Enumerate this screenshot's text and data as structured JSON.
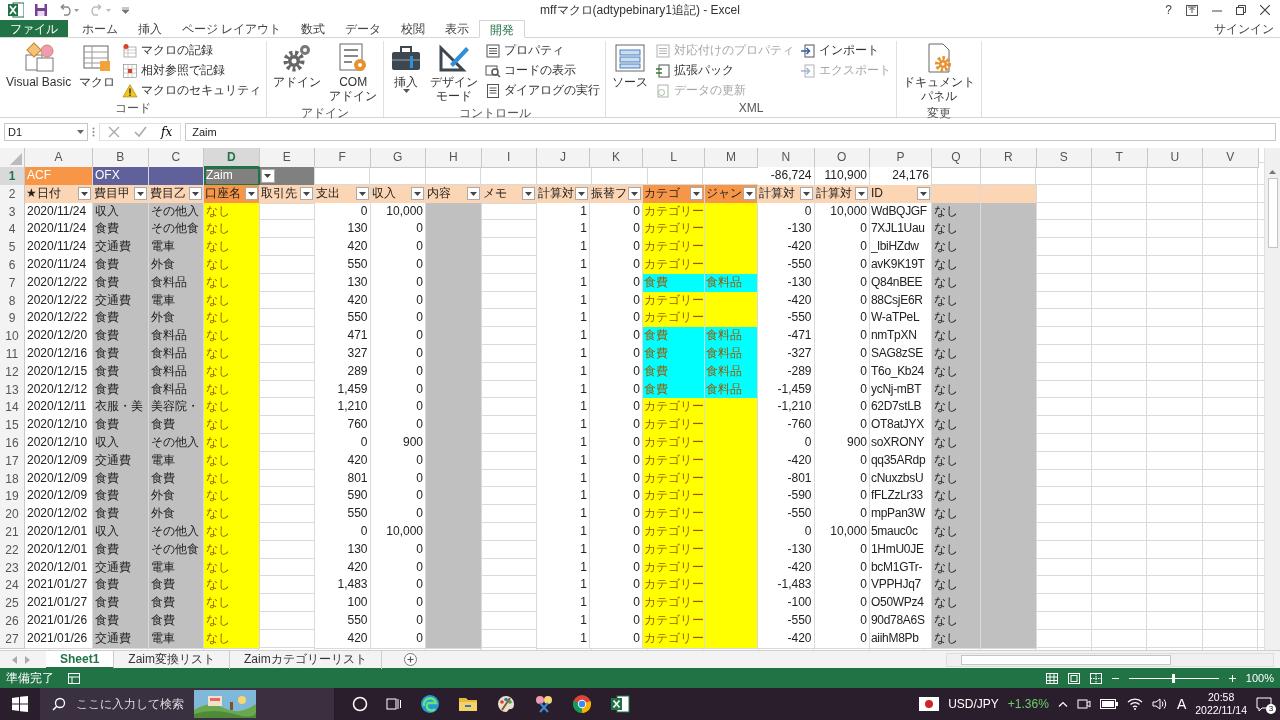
{
  "window": {
    "title": "mffマクロ(adtypebinary1追記) - Excel",
    "help": "?",
    "account": "サインイン"
  },
  "ribbon_tabs": [
    {
      "label": "ファイル",
      "kind": "file",
      "selected": false
    },
    {
      "label": "ホーム",
      "kind": "tab",
      "selected": false
    },
    {
      "label": "挿入",
      "kind": "tab",
      "selected": false
    },
    {
      "label": "ページ レイアウト",
      "kind": "tab",
      "selected": false
    },
    {
      "label": "数式",
      "kind": "tab",
      "selected": false
    },
    {
      "label": "データ",
      "kind": "tab",
      "selected": false
    },
    {
      "label": "校閲",
      "kind": "tab",
      "selected": false
    },
    {
      "label": "表示",
      "kind": "tab",
      "selected": false
    },
    {
      "label": "開発",
      "kind": "tab",
      "selected": true
    }
  ],
  "ribbon_groups": [
    {
      "name": "コード",
      "items": [
        {
          "kind": "large",
          "lines": [
            "Visual Basic"
          ],
          "disabled": false
        },
        {
          "kind": "large",
          "lines": [
            "マクロ"
          ],
          "disabled": false
        },
        {
          "kind": "small",
          "label": "マクロの記録",
          "disabled": false
        },
        {
          "kind": "small",
          "label": "相対参照で記録",
          "disabled": false
        },
        {
          "kind": "small",
          "label": "マクロのセキュリティ",
          "disabled": false
        }
      ]
    },
    {
      "name": "アドイン",
      "items": [
        {
          "kind": "large",
          "lines": [
            "アドイン"
          ],
          "disabled": false
        },
        {
          "kind": "large",
          "lines": [
            "COM",
            "アドイン"
          ],
          "disabled": false
        }
      ]
    },
    {
      "name": "コントロール",
      "items": [
        {
          "kind": "large",
          "lines": [
            "挿入"
          ],
          "disabled": false,
          "dropdown": true
        },
        {
          "kind": "large",
          "lines": [
            "デザイン",
            "モード"
          ],
          "disabled": false
        },
        {
          "kind": "small",
          "label": "プロパティ",
          "disabled": false
        },
        {
          "kind": "small",
          "label": "コードの表示",
          "disabled": false
        },
        {
          "kind": "small",
          "label": "ダイアログの実行",
          "disabled": false
        }
      ]
    },
    {
      "name": "XML",
      "items": [
        {
          "kind": "large",
          "lines": [
            "ソース"
          ],
          "disabled": false
        },
        {
          "kind": "small",
          "label": "対応付けのプロパティ",
          "disabled": true
        },
        {
          "kind": "small",
          "label": "拡張パック",
          "disabled": false
        },
        {
          "kind": "small",
          "label": "データの更新",
          "disabled": true
        },
        {
          "kind": "small",
          "label": "インポート",
          "disabled": false
        },
        {
          "kind": "small",
          "label": "エクスポート",
          "disabled": true
        }
      ]
    },
    {
      "name": "変更",
      "items": [
        {
          "kind": "large",
          "lines": [
            "ドキュメント",
            "パネル"
          ],
          "disabled": false
        }
      ]
    }
  ],
  "formula_bar": {
    "name_box": "D1",
    "fx": "fx",
    "formula": "Zaim"
  },
  "sheet": {
    "columns": [
      {
        "letter": "A",
        "selected": false,
        "kind": "text",
        "header": {
          "text": "★日付",
          "color": "#fcd5b4"
        },
        "filter": true
      },
      {
        "letter": "B",
        "selected": false,
        "kind": "text",
        "header": {
          "text": "費目甲",
          "color": "#fcd5b4"
        },
        "filter": true,
        "color": "#c0c0c0"
      },
      {
        "letter": "C",
        "selected": false,
        "kind": "text",
        "header": {
          "text": "費目乙",
          "color": "#fcd5b4"
        },
        "filter": true,
        "color": "#c0c0c0"
      },
      {
        "letter": "D",
        "selected": true,
        "kind": "account",
        "header": {
          "text": "口座名",
          "color": "#f79646"
        },
        "filter": true,
        "color": "#ffff00"
      },
      {
        "letter": "E",
        "selected": false,
        "kind": "text",
        "header": {
          "text": "取引先",
          "color": "#fcd5b4"
        },
        "filter": true
      },
      {
        "letter": "F",
        "selected": false,
        "kind": "number",
        "header": {
          "text": "支出",
          "color": "#fcd5b4"
        },
        "filter": true
      },
      {
        "letter": "G",
        "selected": false,
        "kind": "number",
        "header": {
          "text": "収入",
          "color": "#fcd5b4"
        },
        "filter": true
      },
      {
        "letter": "H",
        "selected": false,
        "kind": "text",
        "header": {
          "text": "内容",
          "color": "#fcd5b4"
        },
        "filter": true,
        "color": "#c0c0c0"
      },
      {
        "letter": "I",
        "selected": false,
        "kind": "text",
        "header": {
          "text": "メモ",
          "color": "#fcd5b4"
        },
        "filter": true
      },
      {
        "letter": "J",
        "selected": false,
        "kind": "number",
        "header": {
          "text": "計算対",
          "color": "#fcd5b4"
        },
        "filter": true
      },
      {
        "letter": "K",
        "selected": false,
        "kind": "number",
        "header": {
          "text": "振替フ",
          "color": "#fcd5b4"
        },
        "filter": true
      },
      {
        "letter": "L",
        "selected": false,
        "kind": "category",
        "header": {
          "text": "カテゴ",
          "color": "#f79646"
        },
        "filter": true
      },
      {
        "letter": "M",
        "selected": false,
        "kind": "category",
        "header": {
          "text": "ジャン",
          "color": "#f79646"
        },
        "filter": true
      },
      {
        "letter": "N",
        "selected": false,
        "kind": "number",
        "header": {
          "text": "計算対",
          "color": "#fcd5b4"
        },
        "filter": true
      },
      {
        "letter": "O",
        "selected": false,
        "kind": "number",
        "header": {
          "text": "計算対",
          "color": "#fcd5b4"
        },
        "filter": true
      },
      {
        "letter": "P",
        "selected": false,
        "kind": "id",
        "header": {
          "text": "ID",
          "color": "#fcd5b4"
        },
        "filter": true
      },
      {
        "letter": "Q",
        "selected": false,
        "kind": "text",
        "header": {
          "color": "#fcd5b4"
        },
        "filter": false,
        "color": "#c0c0c0"
      },
      {
        "letter": "R",
        "selected": false,
        "kind": "text",
        "header": {
          "color": "#fcd5b4"
        },
        "filter": false,
        "color": "#c0c0c0"
      },
      {
        "letter": "S",
        "selected": false,
        "kind": "text"
      },
      {
        "letter": "T",
        "selected": false,
        "kind": "text"
      },
      {
        "letter": "U",
        "selected": false,
        "kind": "text"
      },
      {
        "letter": "V",
        "selected": false,
        "kind": "text"
      }
    ],
    "row1": {
      "number": "1",
      "selected": true,
      "cells": {
        "A": {
          "text": "ACF",
          "color": "#f79646",
          "selected": false
        },
        "B": {
          "text": "OFX",
          "color": "#60609a",
          "selected": false
        },
        "C": {
          "color": "#60609a",
          "selected": false
        },
        "D": {
          "text": "Zaim",
          "color": "#808080",
          "dropdown": true,
          "selected": true
        },
        "E": {
          "color": "#808080",
          "selected": false
        },
        "N": {
          "text": "-86,724",
          "selected": false
        },
        "O": {
          "text": "110,900",
          "selected": false
        },
        "P": {
          "text": "24,176",
          "selected": false
        }
      }
    },
    "row2": {
      "number": "2",
      "selected": false
    },
    "rows": [
      {
        "number": "3",
        "selected": false,
        "color": "#ffff00",
        "A": "2020/11/24",
        "B": "収入",
        "C": "その他入",
        "D": "なし",
        "F": "0",
        "G": "10,000",
        "J": "1",
        "K": "0",
        "L": "カテゴリー",
        "N": "0",
        "O": "10,000",
        "P": "WdBQJGF",
        "Q": "なし"
      },
      {
        "number": "4",
        "selected": false,
        "color": "#ffff00",
        "A": "2020/11/24",
        "B": "食費",
        "C": "その他食",
        "D": "なし",
        "F": "130",
        "G": "0",
        "J": "1",
        "K": "0",
        "L": "カテゴリー",
        "N": "-130",
        "O": "0",
        "P": "7XJL1Uau",
        "Q": "なし"
      },
      {
        "number": "5",
        "selected": false,
        "color": "#ffff00",
        "A": "2020/11/24",
        "B": "交通費",
        "C": "電車",
        "D": "なし",
        "F": "420",
        "G": "0",
        "J": "1",
        "K": "0",
        "L": "カテゴリー",
        "N": "-420",
        "O": "0",
        "P": "_lbiHZdw",
        "Q": "なし"
      },
      {
        "number": "6",
        "selected": false,
        "color": "#ffff00",
        "A": "2020/11/24",
        "B": "食費",
        "C": "外食",
        "D": "なし",
        "F": "550",
        "G": "0",
        "J": "1",
        "K": "0",
        "L": "カテゴリー",
        "N": "-550",
        "O": "0",
        "P": "avK9K19T",
        "Q": "なし"
      },
      {
        "number": "7",
        "selected": false,
        "color": "#00ffff",
        "A": "2020/12/22",
        "B": "食費",
        "C": "食料品",
        "D": "なし",
        "F": "130",
        "G": "0",
        "J": "1",
        "K": "0",
        "L": "食費",
        "M": "食料品",
        "N": "-130",
        "O": "0",
        "P": "Q84nBEE",
        "Q": "なし"
      },
      {
        "number": "8",
        "selected": false,
        "color": "#ffff00",
        "A": "2020/12/22",
        "B": "交通費",
        "C": "電車",
        "D": "なし",
        "F": "420",
        "G": "0",
        "J": "1",
        "K": "0",
        "L": "カテゴリー",
        "N": "-420",
        "O": "0",
        "P": "88CsjE6R",
        "Q": "なし"
      },
      {
        "number": "9",
        "selected": false,
        "color": "#ffff00",
        "A": "2020/12/22",
        "B": "食費",
        "C": "外食",
        "D": "なし",
        "F": "550",
        "G": "0",
        "J": "1",
        "K": "0",
        "L": "カテゴリー",
        "N": "-550",
        "O": "0",
        "P": "W-aTPeL",
        "Q": "なし"
      },
      {
        "number": "10",
        "selected": false,
        "color": "#00ffff",
        "A": "2020/12/20",
        "B": "食費",
        "C": "食料品",
        "D": "なし",
        "F": "471",
        "G": "0",
        "J": "1",
        "K": "0",
        "L": "食費",
        "M": "食料品",
        "N": "-471",
        "O": "0",
        "P": "nmTpXN",
        "Q": "なし"
      },
      {
        "number": "11",
        "selected": false,
        "color": "#00ffff",
        "A": "2020/12/16",
        "B": "食費",
        "C": "食料品",
        "D": "なし",
        "F": "327",
        "G": "0",
        "J": "1",
        "K": "0",
        "L": "食費",
        "M": "食料品",
        "N": "-327",
        "O": "0",
        "P": "SAG8zSE",
        "Q": "なし"
      },
      {
        "number": "12",
        "selected": false,
        "color": "#00ffff",
        "A": "2020/12/15",
        "B": "食費",
        "C": "食料品",
        "D": "なし",
        "F": "289",
        "G": "0",
        "J": "1",
        "K": "0",
        "L": "食費",
        "M": "食料品",
        "N": "-289",
        "O": "0",
        "P": "T6o_Kb24",
        "Q": "なし"
      },
      {
        "number": "13",
        "selected": false,
        "color": "#00ffff",
        "A": "2020/12/12",
        "B": "食費",
        "C": "食料品",
        "D": "なし",
        "F": "1,459",
        "G": "0",
        "J": "1",
        "K": "0",
        "L": "食費",
        "M": "食料品",
        "N": "-1,459",
        "O": "0",
        "P": "ycNj-mBT",
        "Q": "なし"
      },
      {
        "number": "14",
        "selected": false,
        "color": "#ffff00",
        "A": "2020/12/11",
        "B": "衣服・美",
        "C": "美容院・",
        "D": "なし",
        "F": "1,210",
        "G": "0",
        "J": "1",
        "K": "0",
        "L": "カテゴリー",
        "N": "-1,210",
        "O": "0",
        "P": "62D7stLB",
        "Q": "なし"
      },
      {
        "number": "15",
        "selected": false,
        "color": "#ffff00",
        "A": "2020/12/10",
        "B": "食費",
        "C": "食費",
        "D": "なし",
        "F": "760",
        "G": "0",
        "J": "1",
        "K": "0",
        "L": "カテゴリー",
        "N": "-760",
        "O": "0",
        "P": "OT8atJYX",
        "Q": "なし"
      },
      {
        "number": "16",
        "selected": false,
        "color": "#ffff00",
        "A": "2020/12/10",
        "B": "収入",
        "C": "その他入",
        "D": "なし",
        "F": "0",
        "G": "900",
        "J": "1",
        "K": "0",
        "L": "カテゴリー",
        "N": "0",
        "O": "900",
        "P": "soXRONY",
        "Q": "なし"
      },
      {
        "number": "17",
        "selected": false,
        "color": "#ffff00",
        "A": "2020/12/09",
        "B": "交通費",
        "C": "電車",
        "D": "なし",
        "F": "420",
        "G": "0",
        "J": "1",
        "K": "0",
        "L": "カテゴリー",
        "N": "-420",
        "O": "0",
        "P": "qq35ARdp",
        "Q": "なし"
      },
      {
        "number": "18",
        "selected": false,
        "color": "#ffff00",
        "A": "2020/12/09",
        "B": "食費",
        "C": "食費",
        "D": "なし",
        "F": "801",
        "G": "0",
        "J": "1",
        "K": "0",
        "L": "カテゴリー",
        "N": "-801",
        "O": "0",
        "P": "cNuxzbsU",
        "Q": "なし"
      },
      {
        "number": "19",
        "selected": false,
        "color": "#ffff00",
        "A": "2020/12/09",
        "B": "食費",
        "C": "外食",
        "D": "なし",
        "F": "590",
        "G": "0",
        "J": "1",
        "K": "0",
        "L": "カテゴリー",
        "N": "-590",
        "O": "0",
        "P": "fFLZzLr33",
        "Q": "なし"
      },
      {
        "number": "20",
        "selected": false,
        "color": "#ffff00",
        "A": "2020/12/02",
        "B": "食費",
        "C": "外食",
        "D": "なし",
        "F": "550",
        "G": "0",
        "J": "1",
        "K": "0",
        "L": "カテゴリー",
        "N": "-550",
        "O": "0",
        "P": "mpPan3W",
        "Q": "なし"
      },
      {
        "number": "21",
        "selected": false,
        "color": "#ffff00",
        "A": "2020/12/01",
        "B": "収入",
        "C": "その他入",
        "D": "なし",
        "F": "0",
        "G": "10,000",
        "J": "1",
        "K": "0",
        "L": "カテゴリー",
        "N": "0",
        "O": "10,000",
        "P": "5mauc0c",
        "Q": "なし"
      },
      {
        "number": "22",
        "selected": false,
        "color": "#ffff00",
        "A": "2020/12/01",
        "B": "食費",
        "C": "その他食",
        "D": "なし",
        "F": "130",
        "G": "0",
        "J": "1",
        "K": "0",
        "L": "カテゴリー",
        "N": "-130",
        "O": "0",
        "P": "1HmU0JE",
        "Q": "なし"
      },
      {
        "number": "23",
        "selected": false,
        "color": "#ffff00",
        "A": "2020/12/01",
        "B": "交通費",
        "C": "電車",
        "D": "なし",
        "F": "420",
        "G": "0",
        "J": "1",
        "K": "0",
        "L": "カテゴリー",
        "N": "-420",
        "O": "0",
        "P": "bcM1GTr-",
        "Q": "なし"
      },
      {
        "number": "24",
        "selected": false,
        "color": "#ffff00",
        "A": "2021/01/27",
        "B": "食費",
        "C": "食費",
        "D": "なし",
        "F": "1,483",
        "G": "0",
        "J": "1",
        "K": "0",
        "L": "カテゴリー",
        "N": "-1,483",
        "O": "0",
        "P": "VPPHJq7",
        "Q": "なし"
      },
      {
        "number": "25",
        "selected": false,
        "color": "#ffff00",
        "A": "2021/01/27",
        "B": "食費",
        "C": "食費",
        "D": "なし",
        "F": "100",
        "G": "0",
        "J": "1",
        "K": "0",
        "L": "カテゴリー",
        "N": "-100",
        "O": "0",
        "P": "O50WPz4",
        "Q": "なし"
      },
      {
        "number": "26",
        "selected": false,
        "color": "#ffff00",
        "A": "2021/01/26",
        "B": "食費",
        "C": "食費",
        "D": "なし",
        "F": "550",
        "G": "0",
        "J": "1",
        "K": "0",
        "L": "カテゴリー",
        "N": "-550",
        "O": "0",
        "P": "90d78A6S",
        "Q": "なし"
      },
      {
        "number": "27",
        "selected": false,
        "color": "#ffff00",
        "A": "2021/01/26",
        "B": "交通費",
        "C": "電車",
        "D": "なし",
        "F": "420",
        "G": "0",
        "J": "1",
        "K": "0",
        "L": "カテゴリー",
        "N": "-420",
        "O": "0",
        "P": "aiihM8Pb",
        "Q": "なし"
      }
    ]
  },
  "sheet_tabs": [
    {
      "label": "Sheet1",
      "selected": true
    },
    {
      "label": "Zaim変換リスト",
      "selected": false
    },
    {
      "label": "Zaimカテゴリーリスト",
      "selected": false
    }
  ],
  "status_bar": {
    "text": "準備完了",
    "zoom_slider": {
      "level": 0.5
    },
    "zoom": "100%"
  },
  "taskbar": {
    "search_placeholder": "ここに入力して検索",
    "ticker": "USD/JPY",
    "change": "+1.36%",
    "ime": "A",
    "time": "20:58",
    "date": "2022/11/14",
    "notifications": "3"
  }
}
